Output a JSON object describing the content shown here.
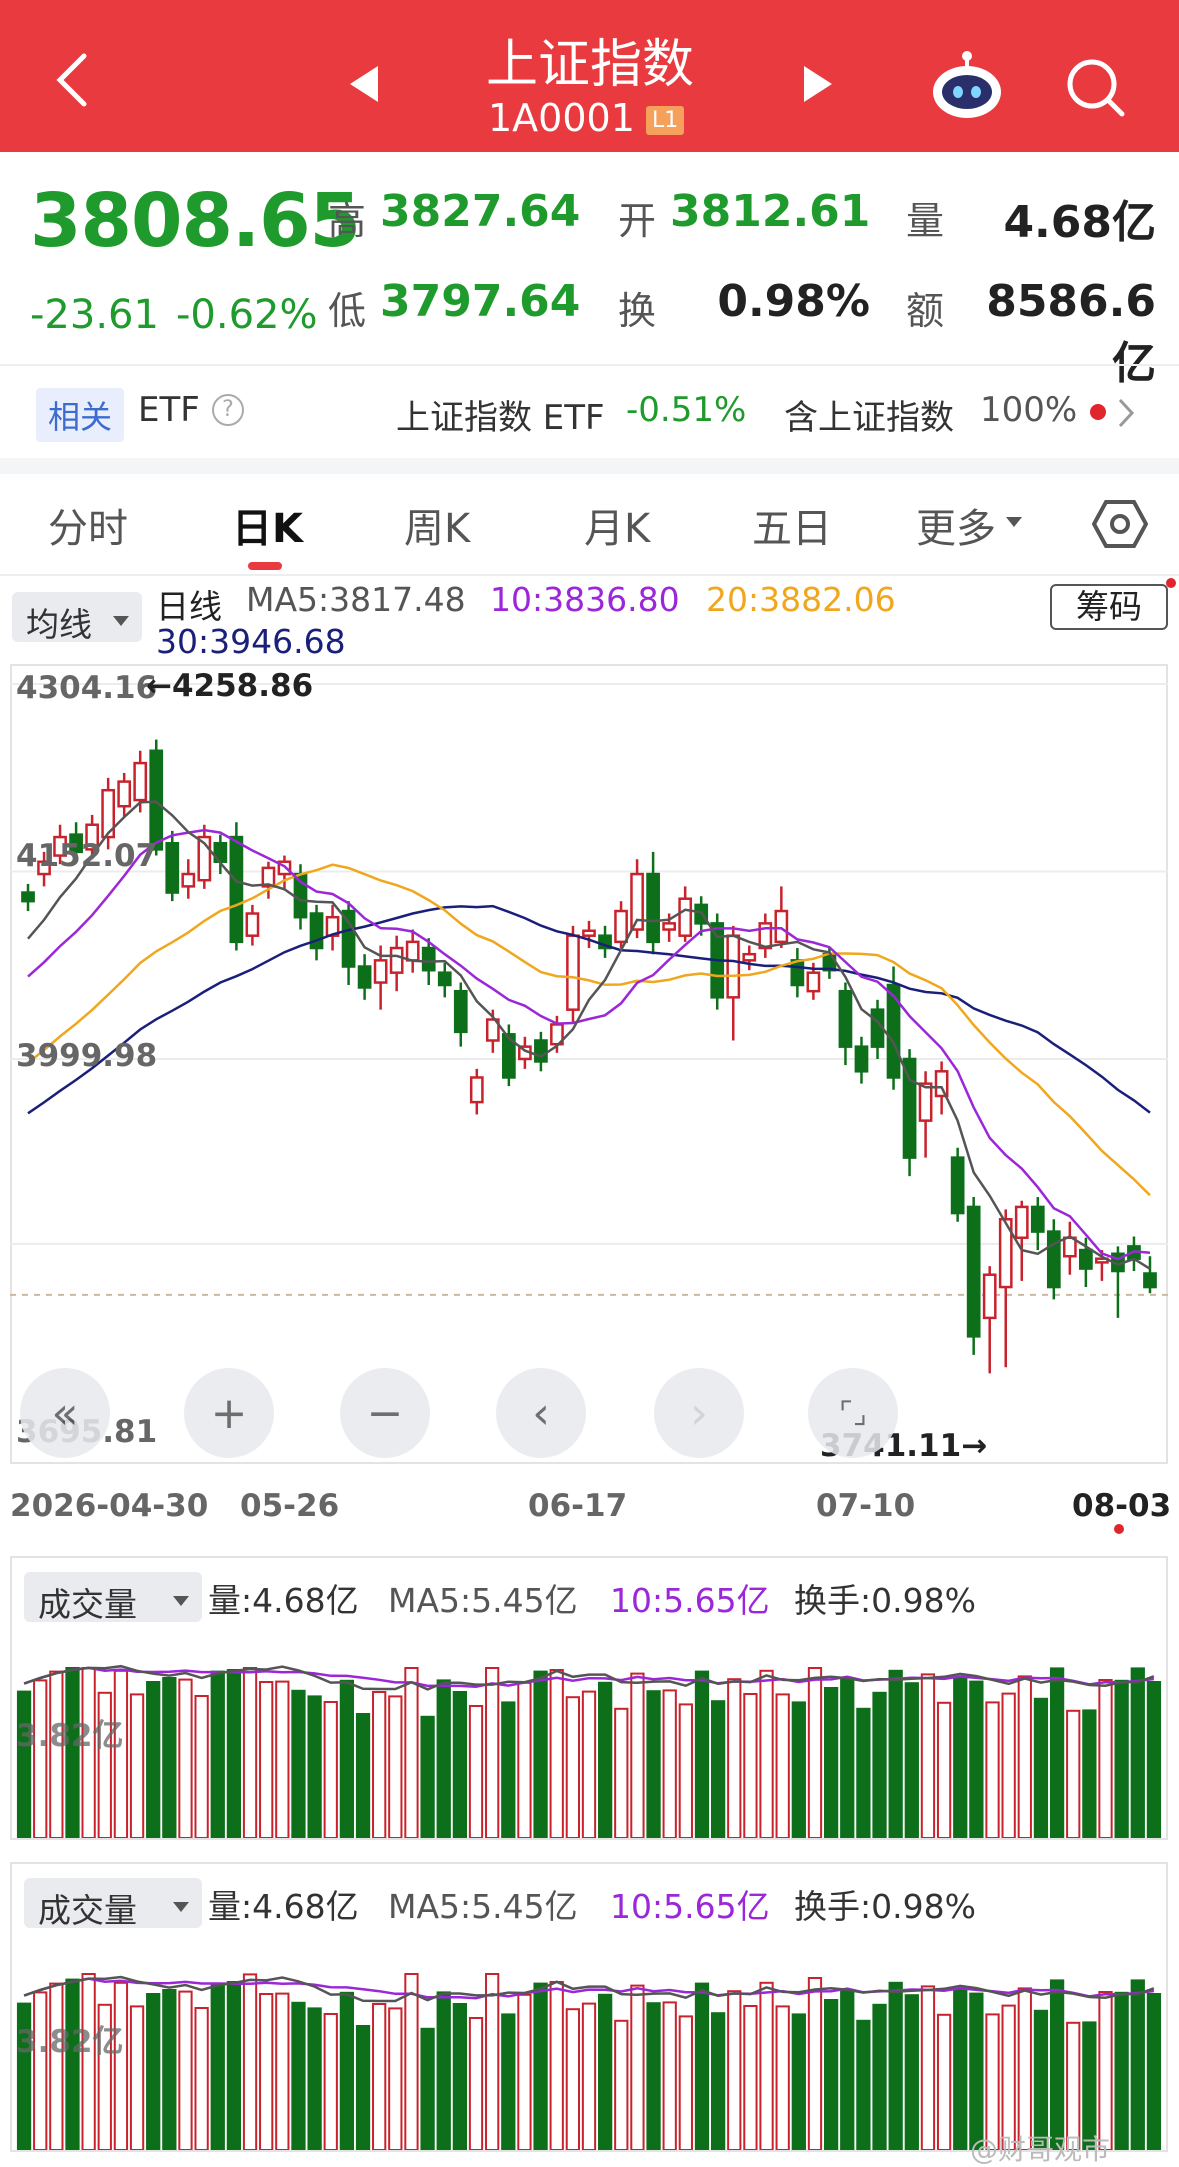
{
  "header": {
    "title": "上证指数",
    "code": "1A0001",
    "level": "L1",
    "prev_icon": "triangle-left-icon",
    "next_icon": "triangle-right-icon"
  },
  "quote": {
    "price": "3808.65",
    "change": "-23.61",
    "change_pct": "-0.62%",
    "high_label": "高",
    "high": "3827.64",
    "open_label": "开",
    "open": "3812.61",
    "volume_label": "量",
    "volume": "4.68亿",
    "low_label": "低",
    "low": "3797.64",
    "turnover_label": "换",
    "turnover": "0.98%",
    "amount_label": "额",
    "amount": "8586.6亿"
  },
  "etf_bar": {
    "tag": "相关",
    "label": "ETF",
    "help": "?",
    "name": "上证指数 ETF",
    "change": "-0.51%",
    "contain": "含上证指数",
    "contain_pct": "100%"
  },
  "tabs": [
    "分时",
    "日K",
    "周K",
    "月K",
    "五日",
    "更多"
  ],
  "active_tab": "日K",
  "chart_toolbar": {
    "ma_select": "均线",
    "period": "日线",
    "ma5": "MA5:3817.48",
    "ma10": "10:3836.80",
    "ma20": "20:3882.06",
    "ma30": "30:3946.68",
    "chips_button": "筹码"
  },
  "colors": {
    "brand_red": "#e83a3f",
    "up": "#c8232c",
    "down": "#0d6f1a",
    "ma5": "#555555",
    "ma10": "#9b27d8",
    "ma20": "#f0a71d",
    "ma30": "#1a1f7a"
  },
  "chart_data": {
    "type": "candlestick",
    "y_axis_labels": [
      "4304.16",
      "4152.07",
      "3999.98",
      "3695.81"
    ],
    "x_axis_labels": [
      "2026-04-30",
      "05-26",
      "06-17",
      "07-10",
      "08-03"
    ],
    "max_annotation": "←4258.86",
    "min_annotation": "3741.11→",
    "ylim": [
      3695.81,
      4304.16
    ],
    "candles": [
      [
        4135,
        4128,
        4142,
        4120
      ],
      [
        4150,
        4160,
        4168,
        4140
      ],
      [
        4165,
        4180,
        4190,
        4158
      ],
      [
        4182,
        4168,
        4192,
        4160
      ],
      [
        4170,
        4190,
        4198,
        4162
      ],
      [
        4180,
        4218,
        4228,
        4170
      ],
      [
        4205,
        4225,
        4232,
        4196
      ],
      [
        4210,
        4240,
        4250,
        4200
      ],
      [
        4250,
        4170,
        4259,
        4165
      ],
      [
        4175,
        4135,
        4185,
        4128
      ],
      [
        4140,
        4150,
        4162,
        4130
      ],
      [
        4145,
        4180,
        4190,
        4138
      ],
      [
        4175,
        4160,
        4182,
        4150
      ],
      [
        4180,
        4095,
        4192,
        4088
      ],
      [
        4100,
        4118,
        4125,
        4092
      ],
      [
        4140,
        4155,
        4160,
        4130
      ],
      [
        4150,
        4160,
        4165,
        4138
      ],
      [
        4150,
        4115,
        4158,
        4105
      ],
      [
        4118,
        4090,
        4125,
        4080
      ],
      [
        4100,
        4115,
        4125,
        4088
      ],
      [
        4120,
        4075,
        4128,
        4060
      ],
      [
        4075,
        4058,
        4085,
        4048
      ],
      [
        4062,
        4080,
        4092,
        4040
      ],
      [
        4070,
        4090,
        4100,
        4055
      ],
      [
        4080,
        4095,
        4105,
        4070
      ],
      [
        4090,
        4072,
        4098,
        4060
      ],
      [
        4070,
        4060,
        4078,
        4050
      ],
      [
        4055,
        4022,
        4062,
        4010
      ],
      [
        3965,
        3985,
        3992,
        3955
      ],
      [
        4015,
        4032,
        4040,
        4005
      ],
      [
        4020,
        3985,
        4028,
        3978
      ],
      [
        4000,
        4010,
        4018,
        3992
      ],
      [
        4015,
        3998,
        4022,
        3990
      ],
      [
        4012,
        4028,
        4035,
        4005
      ],
      [
        4040,
        4100,
        4108,
        4030
      ],
      [
        4100,
        4104,
        4112,
        4090
      ],
      [
        4100,
        4090,
        4108,
        4082
      ],
      [
        4095,
        4120,
        4128,
        4090
      ],
      [
        4105,
        4150,
        4162,
        4098
      ],
      [
        4150,
        4095,
        4168,
        4085
      ],
      [
        4105,
        4110,
        4118,
        4095
      ],
      [
        4100,
        4130,
        4140,
        4095
      ],
      [
        4125,
        4110,
        4132,
        4100
      ],
      [
        4110,
        4050,
        4118,
        4040
      ],
      [
        4050,
        4100,
        4108,
        4015
      ],
      [
        4080,
        4085,
        4092,
        4072
      ],
      [
        4090,
        4110,
        4118,
        4082
      ],
      [
        4095,
        4120,
        4140,
        4090
      ],
      [
        4080,
        4060,
        4090,
        4050
      ],
      [
        4055,
        4070,
        4078,
        4048
      ],
      [
        4085,
        4072,
        4090,
        4065
      ],
      [
        4055,
        4010,
        4062,
        3995
      ],
      [
        4010,
        3990,
        4018,
        3980
      ],
      [
        4040,
        4010,
        4048,
        4000
      ],
      [
        4060,
        3985,
        4075,
        3975
      ],
      [
        4000,
        3920,
        4008,
        3905
      ],
      [
        3950,
        3980,
        3990,
        3920
      ],
      [
        3970,
        3990,
        3998,
        3955
      ],
      [
        3920,
        3875,
        3928,
        3868
      ],
      [
        3880,
        3775,
        3888,
        3760
      ],
      [
        3790,
        3825,
        3832,
        3745
      ],
      [
        3815,
        3870,
        3878,
        3750
      ],
      [
        3855,
        3880,
        3885,
        3820
      ],
      [
        3880,
        3860,
        3888,
        3845
      ],
      [
        3860,
        3815,
        3870,
        3805
      ],
      [
        3840,
        3855,
        3868,
        3825
      ],
      [
        3845,
        3830,
        3855,
        3815
      ],
      [
        3835,
        3838,
        3845,
        3820
      ],
      [
        3842,
        3828,
        3848,
        3790
      ],
      [
        3848,
        3838,
        3856,
        3828
      ],
      [
        3826,
        3815,
        3840,
        3810
      ]
    ]
  },
  "zoom_controls": {
    "buttons": [
      "«",
      "+",
      "−",
      "‹",
      "›",
      "⌜⌟"
    ]
  },
  "volume_panels": [
    {
      "select": "成交量",
      "volume": "量:4.68亿",
      "ma5": "MA5:5.45亿",
      "ma10": "10:5.65亿",
      "turnover": "换手:0.98%",
      "axis_label": "3.82亿"
    },
    {
      "select": "成交量",
      "volume": "量:4.68亿",
      "ma5": "MA5:5.45亿",
      "ma10": "10:5.65亿",
      "turnover": "换手:0.98%",
      "axis_label": "3.82亿"
    }
  ],
  "watermark": "@财哥观市"
}
